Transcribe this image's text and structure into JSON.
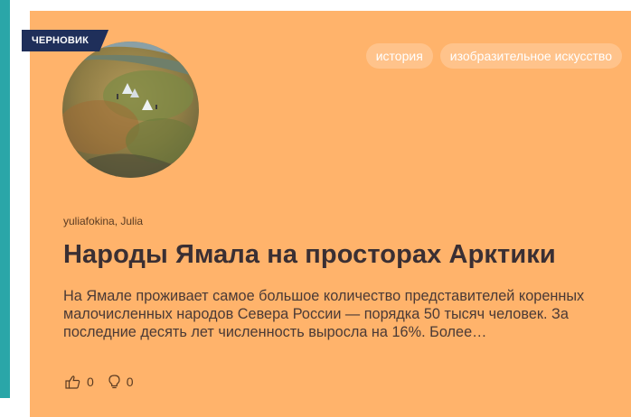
{
  "badge": {
    "draft": "ЧЕРНОВИК"
  },
  "tags": [
    {
      "label": "история"
    },
    {
      "label": "изобразительное искусство"
    }
  ],
  "article": {
    "authors": "yuliafokina, Julia",
    "title": "Народы Ямала на просторах Арктики",
    "excerpt": "На Ямале проживает самое большое количество представителей коренных малочисленных народов Севера России — порядка 50 тысяч человек. За последние десять лет численность выросла на 16%. Более…"
  },
  "stats": {
    "likes": "0",
    "ideas": "0",
    "like_icon": "thumbs-up-icon",
    "idea_icon": "lightbulb-icon"
  },
  "colors": {
    "card_bg": "#ffb36b",
    "accent_bar": "#2aa6a8",
    "badge_bg": "#1f2f5a",
    "title": "#3a2f33"
  }
}
